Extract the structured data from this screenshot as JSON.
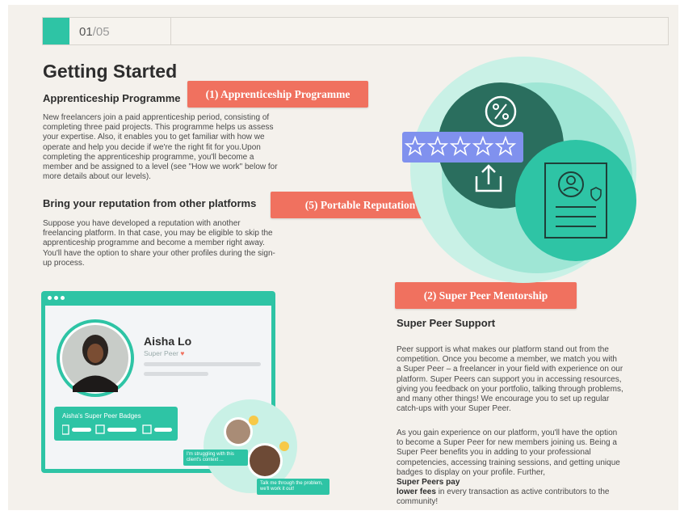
{
  "pager": {
    "current": "01",
    "total": "/05"
  },
  "title": "Getting Started",
  "apprenticeship": {
    "heading": "Apprenticeship Programme",
    "lines": [
      "New freelancers join a paid apprenticeship period, consisting of",
      "completing three paid projects. This programme helps us assess",
      "your expertise. Also, it enables you to get familiar with how we",
      "operate and help you decide if we're the right fit for you.Upon",
      "completing the apprenticeship programme, you'll become a",
      "member and be assigned to a level (see \"How we work\" below for",
      "more details about our levels)."
    ]
  },
  "reputation": {
    "heading": "Bring your reputation from other platforms",
    "lines": [
      "Suppose you have developed a reputation with another",
      "freelancing platform. In that case, you may be eligible to skip the",
      "apprenticeship programme and become a member right away.",
      "You'll have the option to share your other profiles during the sign-",
      "up process."
    ]
  },
  "callouts": {
    "c1": "(1) Apprenticeship Programme",
    "c5": "(5) Portable Reputation",
    "c2": "(2) Super Peer Mentorship"
  },
  "superpeer": {
    "heading": "Super Peer Support",
    "p1_lines": [
      "Peer support is what makes our platform stand out from the",
      "competition. Once you become a member, we match you with",
      "a Super Peer – a freelancer in your field with experience on our",
      "platform. Super Peers can support you in accessing resources,",
      "giving you feedback on your portfolio, talking through problems,",
      "and many other things! We encourage you to set up regular",
      "catch-ups with your Super Peer."
    ],
    "p2_lines": [
      "As you gain experience on our platform, you'll have the option",
      "to become a Super Peer for new members joining us. Being a",
      "Super Peer benefits you in adding to your professional",
      "competencies, accessing training sessions, and getting unique",
      "badges to display on your profile. Further,"
    ],
    "p2_bold_a": "Super Peers pay",
    "p2_bold_b": "lower fees",
    "p2_tail": "in every transaction as active contributors to the",
    "p2_last": "community!"
  },
  "profile": {
    "name": "Aisha Lo",
    "role": "Super Peer",
    "badges_label": "Aisha's Super Peer Badges",
    "chat1": "I'm struggling with this client's context ...",
    "chat2": "Talk me through the problem, we'll work it out!"
  },
  "colors": {
    "teal": "#2ec4a5",
    "dark_teal": "#2a6e5e",
    "callout": "#f0715f",
    "star_panel": "#7b8be8"
  }
}
